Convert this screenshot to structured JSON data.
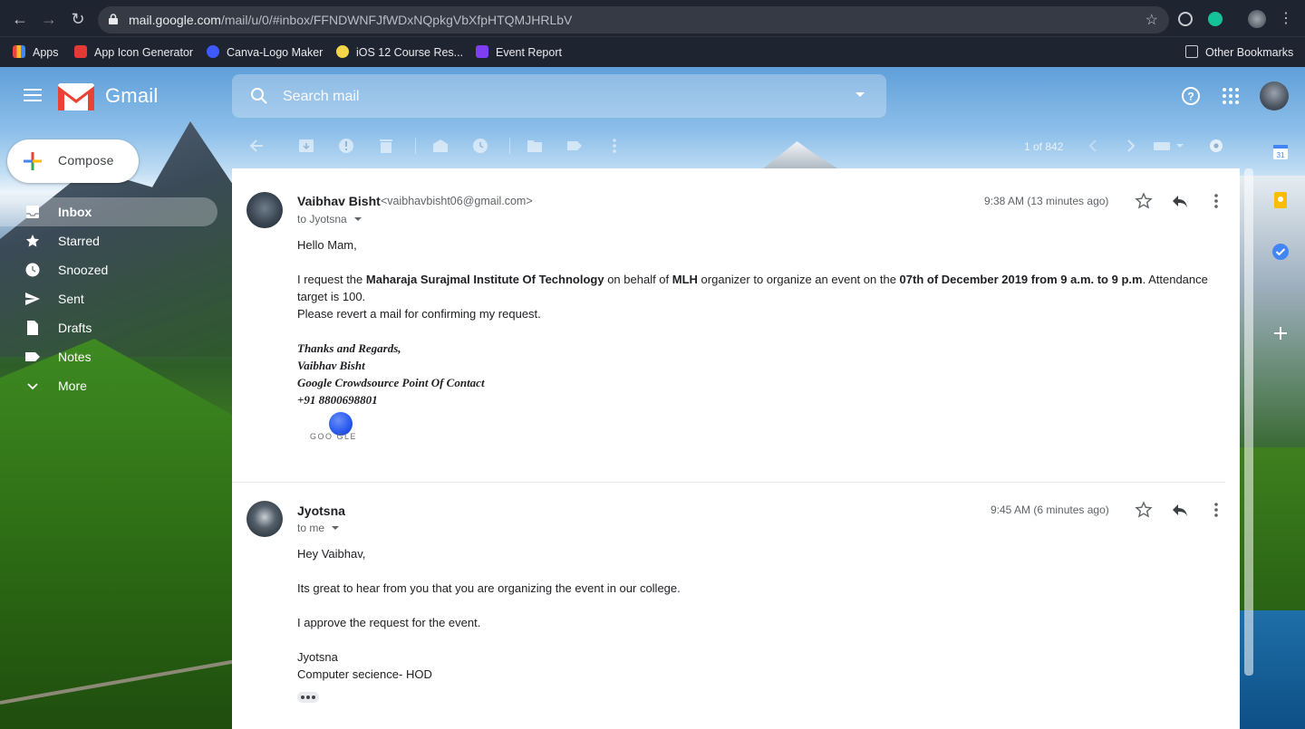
{
  "browser": {
    "url_host": "mail.google.com",
    "url_path": "/mail/u/0/#inbox/FFNDWNFJfWDxNQpkgVbXfpHTQMJHRLbV",
    "bookmarks": [
      {
        "label": "Apps",
        "icon": "apps-grid-icon",
        "color": "#e8453c"
      },
      {
        "label": "App Icon Generator",
        "icon": "app-icon-generator-icon",
        "color": "#e53935"
      },
      {
        "label": "Canva-Logo Maker",
        "icon": "canva-icon",
        "color": "#3d5afe"
      },
      {
        "label": "iOS 12 Course Res...",
        "icon": "ios-course-icon",
        "color": "#f5d547"
      },
      {
        "label": "Event Report",
        "icon": "event-report-icon",
        "color": "#7e3ff2"
      }
    ],
    "other_bookmarks": "Other Bookmarks"
  },
  "gmail": {
    "product_name": "Gmail",
    "search_placeholder": "Search mail",
    "compose_label": "Compose",
    "nav": [
      {
        "label": "Inbox",
        "icon": "inbox-icon",
        "active": true
      },
      {
        "label": "Starred",
        "icon": "star-icon"
      },
      {
        "label": "Snoozed",
        "icon": "clock-icon"
      },
      {
        "label": "Sent",
        "icon": "send-icon"
      },
      {
        "label": "Drafts",
        "icon": "draft-icon"
      },
      {
        "label": "Notes",
        "icon": "label-icon"
      },
      {
        "label": "More",
        "icon": "chevron-down-icon"
      }
    ],
    "toolbar": {
      "page_count": "1 of 842"
    },
    "side_panel": [
      "calendar-icon",
      "keep-icon",
      "tasks-icon",
      "add-icon"
    ],
    "calendar_day": "31"
  },
  "thread": {
    "messages": [
      {
        "sender": "Vaibhav Bisht",
        "sender_email": "<vaibhavbisht06@gmail.com>",
        "to": "to Jyotsna",
        "time": "9:38 AM (13 minutes ago)",
        "greeting": "Hello Mam,",
        "p1_a": "I request the ",
        "p1_b": "Maharaja Surajmal Institute Of Technology",
        "p1_c": " on behalf of ",
        "p1_d": "MLH",
        "p1_e": " organizer to organize an event on the ",
        "p1_f": "07th of December 2019 from 9 a.m. to 9 p.m",
        "p1_g": ". Attendance",
        "p1_line2": "target is 100.",
        "p2": "Please revert a mail for confirming my request.",
        "sig": [
          "Thanks and Regards,",
          "Vaibhav Bisht",
          "Google Crowdsource Point Of Contact",
          "+91 8800698801"
        ],
        "logo_text": "GOO   GLE"
      },
      {
        "sender": "Jyotsna",
        "to": "to me",
        "time": "9:45 AM (6 minutes ago)",
        "lines": [
          "Hey Vaibhav,",
          "Its great to hear from you that you are organizing the event in our college.",
          "I approve the request for the event.",
          "Jyotsna",
          "Computer secience- HOD"
        ]
      }
    ]
  },
  "colors": {
    "accent_blue": "#1a73e8",
    "gmail_red": "#ea4335"
  }
}
